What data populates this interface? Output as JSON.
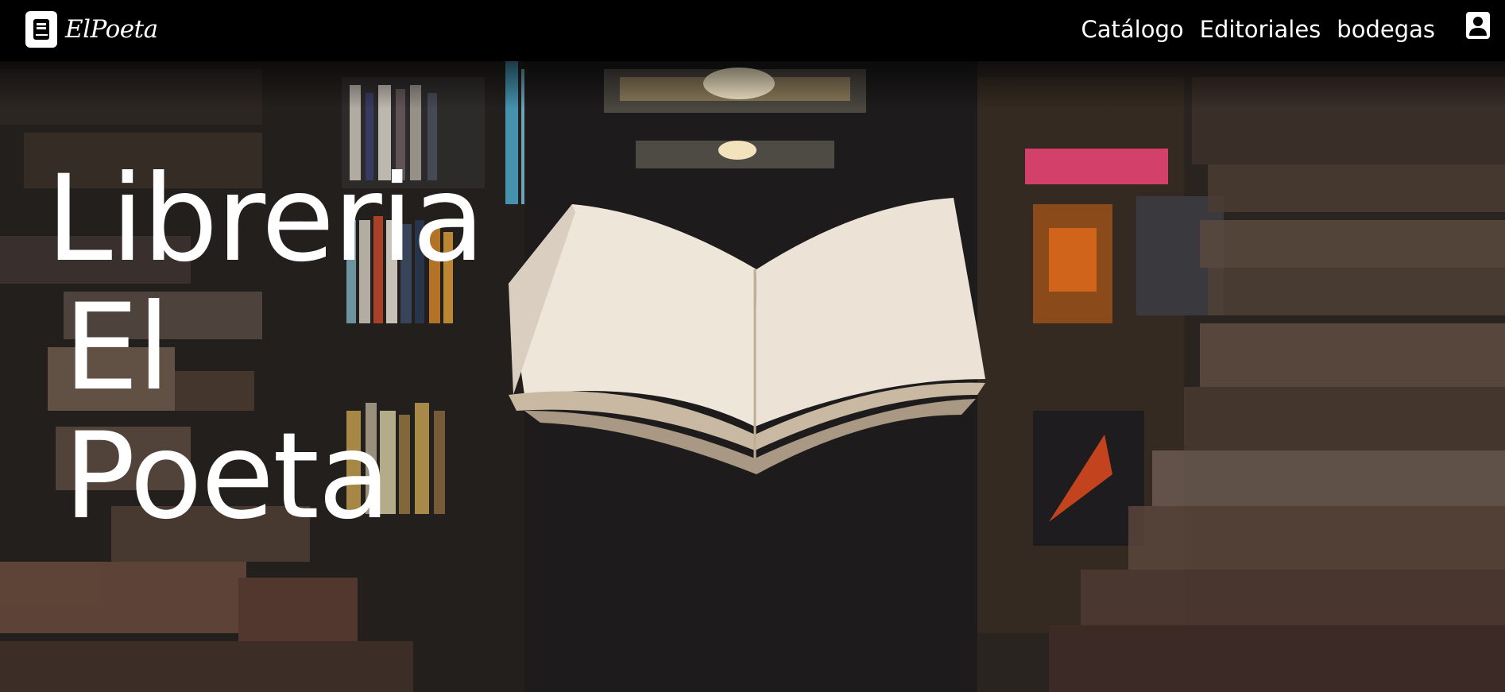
{
  "navbar": {
    "brand": "ElPoeta",
    "brand_icon": "book-icon",
    "links": [
      {
        "label": "Catálogo"
      },
      {
        "label": "Editoriales"
      },
      {
        "label": "bodegas"
      }
    ],
    "user_icon": "user-square-icon"
  },
  "hero": {
    "title_lines": [
      "Libreria",
      "El",
      "Poeta"
    ],
    "background": "bookstore-photo-with-open-book"
  },
  "colors": {
    "navbar_bg": "#000000",
    "text": "#ffffff"
  }
}
